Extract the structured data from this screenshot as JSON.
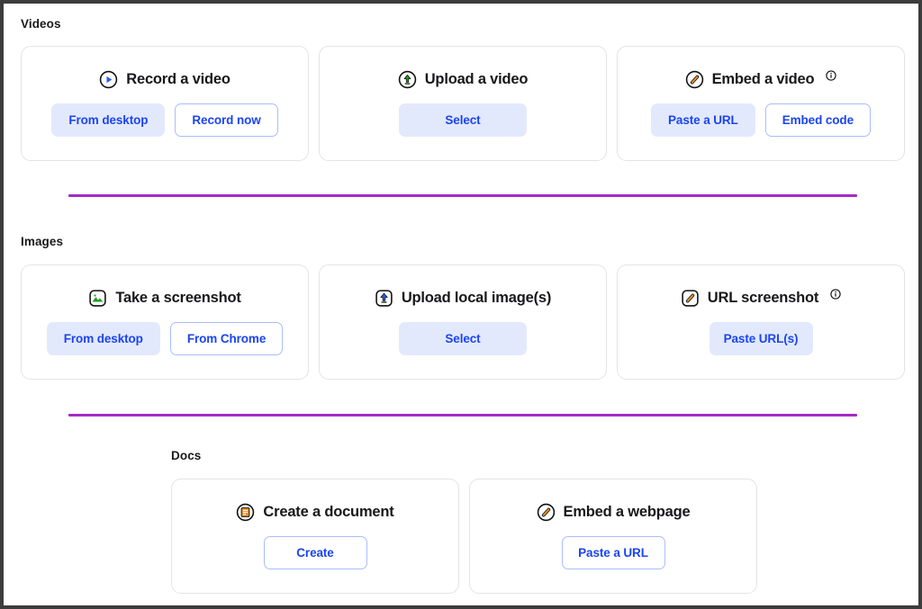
{
  "sections": [
    {
      "label": "Videos",
      "cards": [
        {
          "title": "Record a video",
          "icon": "play-circle-icon",
          "has_info": false,
          "buttons": [
            {
              "label": "From desktop",
              "style": "filled",
              "name": "from-desktop-button"
            },
            {
              "label": "Record now",
              "style": "outline",
              "name": "record-now-button"
            }
          ]
        },
        {
          "title": "Upload a video",
          "icon": "upload-circle-icon",
          "has_info": false,
          "buttons": [
            {
              "label": "Select",
              "style": "filled",
              "name": "select-video-button"
            }
          ]
        },
        {
          "title": "Embed a video",
          "icon": "link-circle-icon",
          "has_info": true,
          "buttons": [
            {
              "label": "Paste a URL",
              "style": "filled",
              "name": "paste-a-url-button"
            },
            {
              "label": "Embed code",
              "style": "outline",
              "name": "embed-code-button"
            }
          ]
        }
      ]
    },
    {
      "label": "Images",
      "cards": [
        {
          "title": "Take a screenshot",
          "icon": "image-square-icon",
          "has_info": false,
          "buttons": [
            {
              "label": "From desktop",
              "style": "filled",
              "name": "from-desktop-button"
            },
            {
              "label": "From Chrome",
              "style": "outline",
              "name": "from-chrome-button"
            }
          ]
        },
        {
          "title": "Upload local image(s)",
          "icon": "upload-square-icon",
          "has_info": false,
          "buttons": [
            {
              "label": "Select",
              "style": "filled",
              "name": "select-image-button"
            }
          ]
        },
        {
          "title": "URL screenshot",
          "icon": "link-square-icon",
          "has_info": true,
          "buttons": [
            {
              "label": "Paste URL(s)",
              "style": "filled",
              "name": "paste-urls-button"
            }
          ]
        }
      ]
    },
    {
      "label": "Docs",
      "cards": [
        {
          "title": "Create a document",
          "icon": "document-circle-icon",
          "has_info": false,
          "buttons": [
            {
              "label": "Create",
              "style": "outline",
              "name": "create-document-button"
            }
          ]
        },
        {
          "title": "Embed a webpage",
          "icon": "link-circle-icon",
          "has_info": false,
          "buttons": [
            {
              "label": "Paste a URL",
              "style": "outline",
              "name": "paste-a-url-button"
            }
          ]
        }
      ]
    }
  ],
  "colors": {
    "divider": "#a62ac6",
    "accent_blue": "#1a44f2",
    "button_fill": "#e3e9fd",
    "button_outline": "#aabdfb",
    "icon_green": "#1aa01a",
    "icon_orange": "#e8932a",
    "card_border": "#e4e4e6",
    "page_border": "#3c3c3c"
  }
}
